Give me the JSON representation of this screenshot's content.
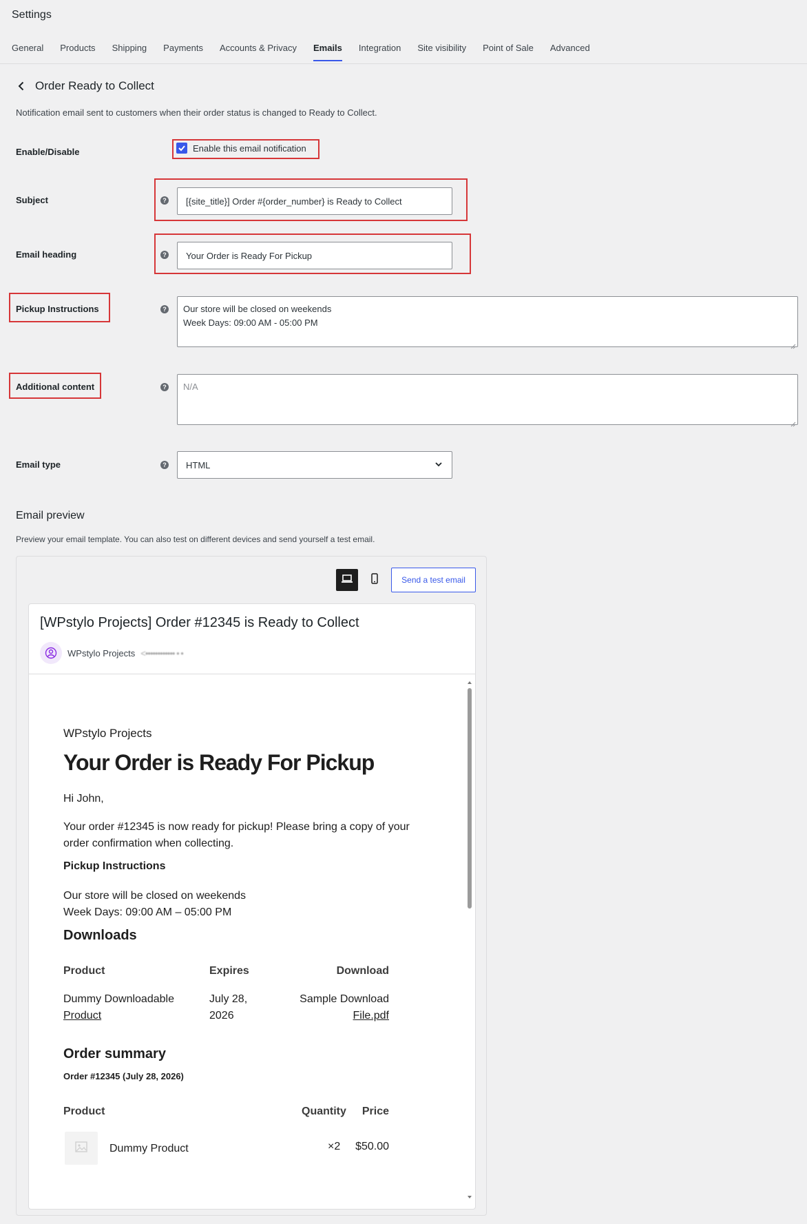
{
  "header": {
    "title": "Settings"
  },
  "tabs": [
    {
      "label": "General"
    },
    {
      "label": "Products"
    },
    {
      "label": "Shipping"
    },
    {
      "label": "Payments"
    },
    {
      "label": "Accounts & Privacy"
    },
    {
      "label": "Emails",
      "active": true
    },
    {
      "label": "Integration"
    },
    {
      "label": "Site visibility"
    },
    {
      "label": "Point of Sale"
    },
    {
      "label": "Advanced"
    }
  ],
  "page": {
    "title": "Order Ready to Collect",
    "description": "Notification email sent to customers when their order status is changed to Ready to Collect."
  },
  "fields": {
    "enable": {
      "label": "Enable/Disable",
      "checkbox_label": "Enable this email notification",
      "checked": true
    },
    "subject": {
      "label": "Subject",
      "value": "[{site_title}] Order #{order_number} is Ready to Collect"
    },
    "heading": {
      "label": "Email heading",
      "value": "Your Order is Ready For Pickup"
    },
    "pickup": {
      "label": "Pickup Instructions",
      "line1": "Our store will be closed on weekends",
      "line2": "Week Days: 09:00 AM - 05:00 PM"
    },
    "additional": {
      "label": "Additional content",
      "placeholder": "N/A"
    },
    "email_type": {
      "label": "Email type",
      "value": "HTML"
    },
    "help_glyph": "?"
  },
  "preview": {
    "title": "Email preview",
    "description": "Preview your email template. You can also test on different devices and send yourself a test email.",
    "send_test_label": "Send a test email",
    "subject": "[WPstylo Projects] Order #12345 is Ready to Collect",
    "sender_name": "WPstylo Projects",
    "sender_email_blurred": "<•••••••••••• • •",
    "body": {
      "store_name": "WPstylo Projects",
      "heading": "Your Order is Ready For Pickup",
      "greeting": "Hi John,",
      "message": "Your order #12345 is now ready for pickup! Please bring a copy of your order confirmation when collecting.",
      "pickup_title": "Pickup Instructions",
      "pickup_line1": "Our store will be closed on weekends",
      "pickup_line2": "Week Days: 09:00 AM – 05:00 PM",
      "downloads_title": "Downloads",
      "downloads_headers": {
        "product": "Product",
        "expires": "Expires",
        "download": "Download"
      },
      "download_row": {
        "product_line1": "Dummy Downloadable",
        "product_line2": "Product",
        "expires_line1": "July 28,",
        "expires_line2": "2026",
        "file_line1": "Sample Download",
        "file_line2": "File.pdf"
      },
      "summary_title": "Order summary",
      "summary_order": "Order #12345 (July 28, 2026)",
      "summary_headers": {
        "product": "Product",
        "quantity": "Quantity",
        "price": "Price"
      },
      "summary_item": {
        "name": "Dummy Product",
        "quantity": "×2",
        "price": "$50.00"
      }
    }
  },
  "colors": {
    "accent": "#3858e9",
    "highlight": "#d63638"
  }
}
